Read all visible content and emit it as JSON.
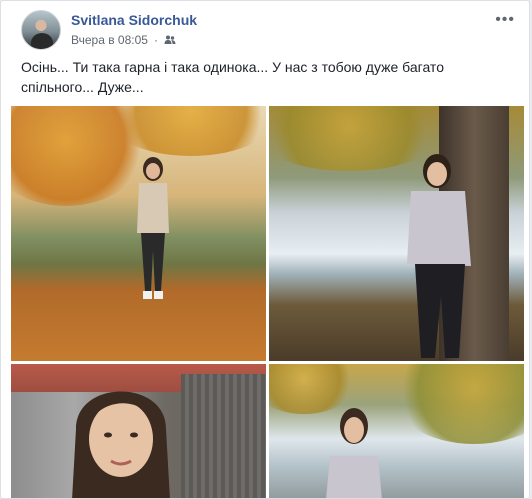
{
  "post": {
    "author": "Svitlana Sidorchuk",
    "timestamp": "Вчера в 08:05",
    "audience_icon": "friends-icon",
    "more_icon": "more-options-icon",
    "text": "Осінь... Ти така гарна і така одинока... У нас з тобою дуже багато спільного... Дуже..."
  },
  "colors": {
    "author_link": "#385898",
    "meta_text": "#616770",
    "body_text": "#1d2129",
    "card_border": "#dddfe2",
    "page_bg": "#e9ebee"
  }
}
